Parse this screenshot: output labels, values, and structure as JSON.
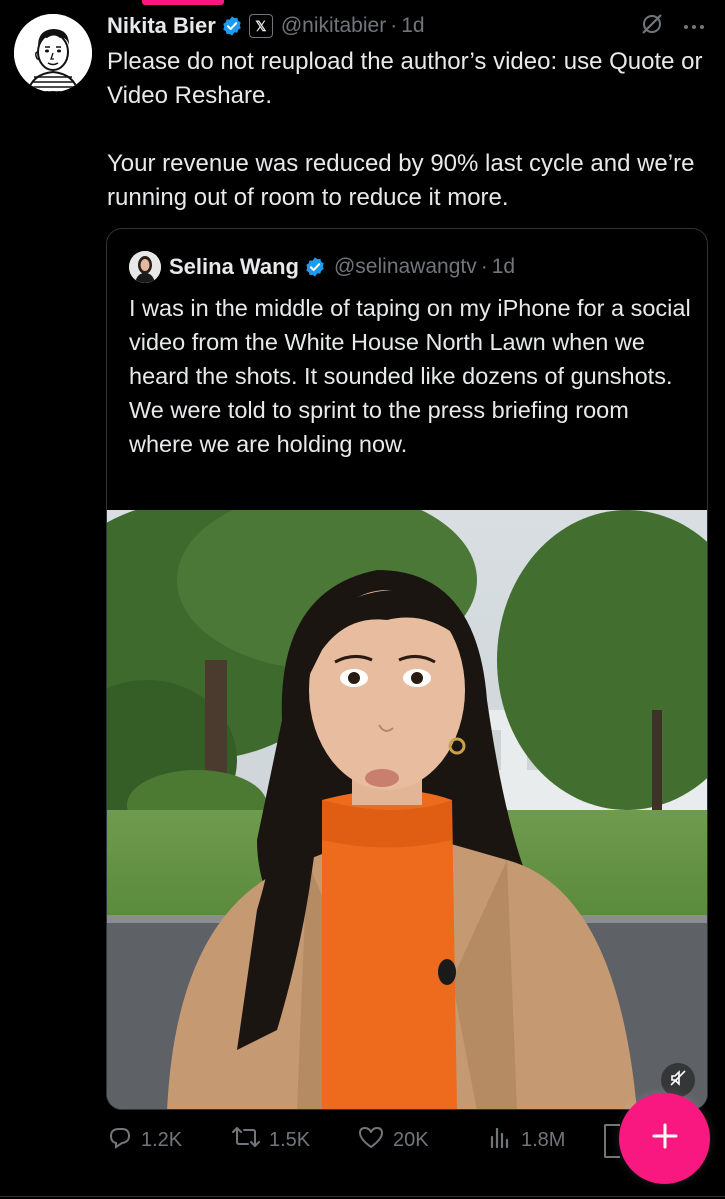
{
  "tweet": {
    "author_name": "Nikita Bier",
    "handle": "@nikitabier",
    "separator": "·",
    "time": "1d",
    "affiliate_badge": "𝕏",
    "text_paragraphs": [
      "Please do not reupload the author’s video: use Quote or Video Reshare.",
      "Your revenue was reduced by 90% last cycle and we’re running out of room to reduce it more."
    ]
  },
  "quoted_tweet": {
    "author_name": "Selina Wang",
    "handle": "@selinawangtv",
    "separator": "·",
    "time": "1d",
    "text": "I was in the middle of taping on my iPhone for a social video from the White House North Lawn when we heard the shots. It sounded like dozens of gunshots. We were told to sprint to the press briefing room where we are holding now."
  },
  "actions": {
    "replies": "1.2K",
    "reposts": "1.5K",
    "likes": "20K",
    "views": "1.8M"
  },
  "fab_label": "+",
  "icons": {
    "verified": "verified-badge-icon",
    "grok": "grok-icon",
    "more": "more-icon",
    "reply": "reply-icon",
    "repost": "repost-icon",
    "like": "like-icon",
    "views": "views-icon",
    "bookmark": "bookmark-icon",
    "mute": "mute-icon",
    "compose": "compose-icon"
  },
  "colors": {
    "background": "#000000",
    "text": "#e7e9ea",
    "muted": "#71767b",
    "verified_blue": "#1d9bf0",
    "accent_pink": "#f91880",
    "border": "#2f3336"
  }
}
